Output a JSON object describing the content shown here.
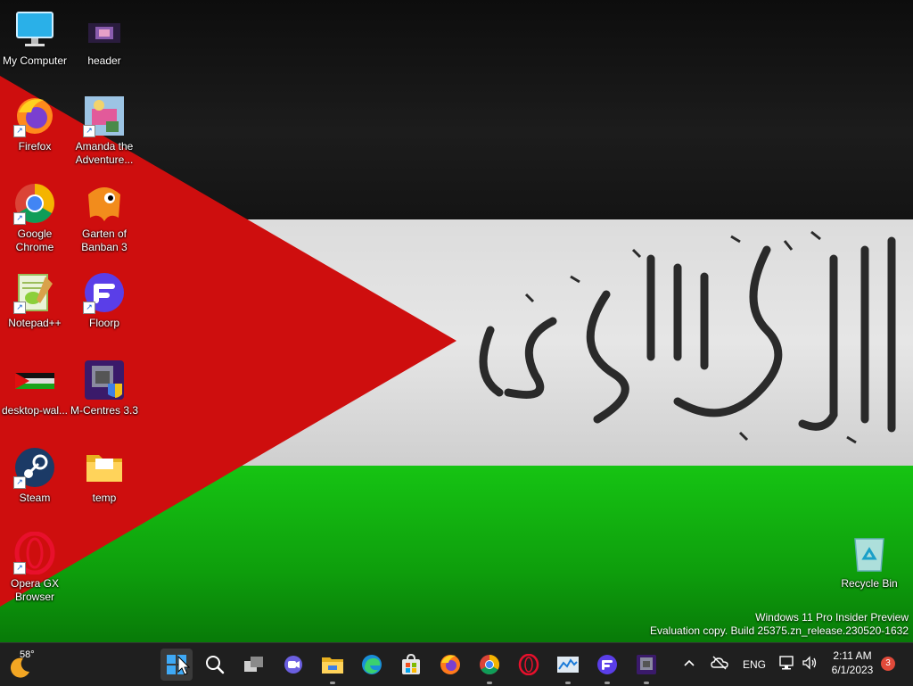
{
  "desktop": {
    "icons": [
      {
        "label": "My Computer",
        "icon": "monitor-icon"
      },
      {
        "label": "header",
        "icon": "image-file-icon"
      },
      {
        "label": "Firefox",
        "icon": "firefox-icon"
      },
      {
        "label": "Amanda the Adventure...",
        "icon": "game-icon"
      },
      {
        "label": "Google Chrome",
        "icon": "chrome-icon"
      },
      {
        "label": "Garten of Banban 3",
        "icon": "game-icon"
      },
      {
        "label": "Notepad++",
        "icon": "notepad-icon"
      },
      {
        "label": "Floorp",
        "icon": "floorp-icon"
      },
      {
        "label": "desktop-wal...",
        "icon": "image-file-icon"
      },
      {
        "label": "M-Centres 3.3",
        "icon": "installer-icon"
      },
      {
        "label": "Steam",
        "icon": "steam-icon"
      },
      {
        "label": "temp",
        "icon": "folder-icon"
      },
      {
        "label": "Opera GX Browser",
        "icon": "opera-icon"
      },
      {
        "label": "Recycle Bin",
        "icon": "recycle-bin-icon"
      }
    ],
    "watermark_line1": "Windows 11 Pro Insider Preview",
    "watermark_line2": "Evaluation copy. Build 25375.zn_release.230520-1632"
  },
  "taskbar": {
    "weather_temp": "58°",
    "apps": [
      "start",
      "search",
      "task-view",
      "chat",
      "file-explorer",
      "edge",
      "store",
      "firefox",
      "chrome",
      "opera",
      "task-manager",
      "floorp",
      "m-centres"
    ],
    "language": "ENG",
    "time": "2:11 AM",
    "date": "6/1/2023",
    "notification_count": "3"
  }
}
